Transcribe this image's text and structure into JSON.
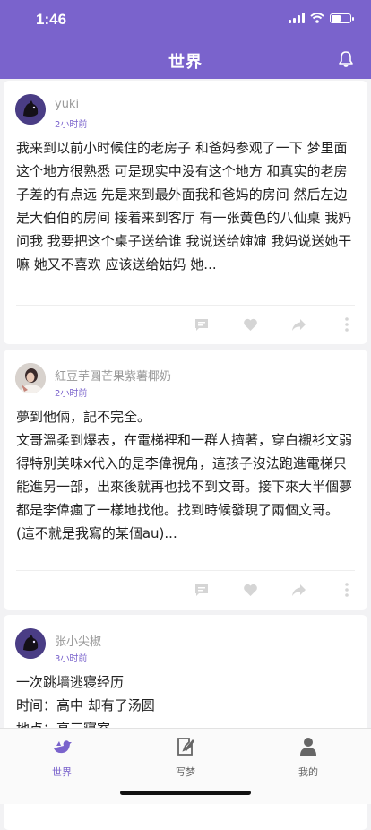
{
  "status": {
    "time": "1:46"
  },
  "nav": {
    "title": "世界"
  },
  "posts": [
    {
      "author": "yuki",
      "time": "2小时前",
      "text": "我来到以前小时候住的老房子 和爸妈参观了一下 梦里面这个地方很熟悉 可是现实中没有这个地方 和真实的老房子差的有点远 先是来到最外面我和爸妈的房间 然后左边是大伯伯的房间 接着来到客厅 有一张黄色的八仙桌 我妈问我 我要把这个桌子送给谁 我说送给婶婶 我妈说送她干嘛 她又不喜欢 应该送给姑妈 她..."
    },
    {
      "author": "紅豆芋圓芒果紫薯椰奶",
      "time": "2小时前",
      "text": "夢到他倆，記不完全。\n文哥溫柔到爆表，在電梯裡和一群人擠著，穿白襯衫文弱得特別美味x代入的是李偉視角，這孩子沒法跑進電梯只能進另一部，出來後就再也找不到文哥。接下來大半個夢都是李偉瘋了一樣地找他。找到時候發現了兩個文哥。(這不就是我寫的某個au)..."
    },
    {
      "author": "张小尖椒",
      "time": "3小时前",
      "text": "一次跳墙逃寝经历\n时间：高中 却有了汤圆\n地点：高三寝室"
    }
  ],
  "tabs": [
    {
      "label": "世界",
      "icon": "bird-icon",
      "active": true
    },
    {
      "label": "写梦",
      "icon": "pen-icon",
      "active": false
    },
    {
      "label": "我的",
      "icon": "person-icon",
      "active": false
    }
  ],
  "colors": {
    "accent": "#7a63cc",
    "background": "#f2f2f4"
  }
}
